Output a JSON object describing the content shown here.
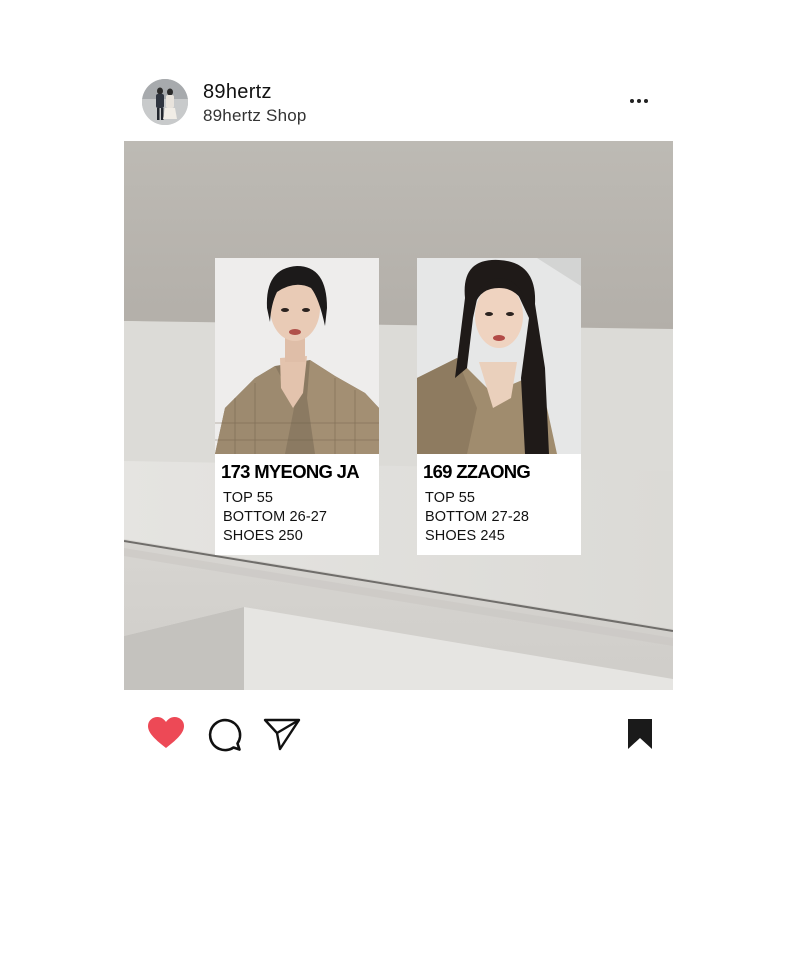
{
  "post": {
    "username": "89hertz",
    "subtitle": "89hertz Shop",
    "more_icon": "more-horizontal-icon"
  },
  "cards": [
    {
      "name": "173 MYEONG JA",
      "lines": [
        "TOP 55",
        "BOTTOM 26-27",
        "SHOES 250"
      ]
    },
    {
      "name": "169 ZZAONG",
      "lines": [
        "TOP 55",
        "BOTTOM 27-28",
        "SHOES 245"
      ]
    }
  ],
  "actions": {
    "like_icon": "heart-icon",
    "like_color": "#ed4956",
    "comment_icon": "comment-icon",
    "share_icon": "send-icon",
    "save_icon": "bookmark-icon",
    "liked": true,
    "saved": true
  }
}
